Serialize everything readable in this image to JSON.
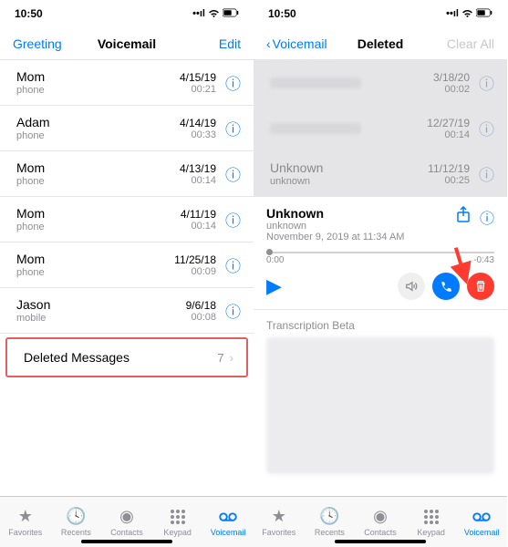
{
  "left": {
    "time": "10:50",
    "nav": {
      "left": "Greeting",
      "title": "Voicemail",
      "right": "Edit"
    },
    "rows": [
      {
        "name": "Mom",
        "sub": "phone",
        "date": "4/15/19",
        "dur": "00:21"
      },
      {
        "name": "Adam",
        "sub": "phone",
        "date": "4/14/19",
        "dur": "00:33"
      },
      {
        "name": "Mom",
        "sub": "phone",
        "date": "4/13/19",
        "dur": "00:14"
      },
      {
        "name": "Mom",
        "sub": "phone",
        "date": "4/11/19",
        "dur": "00:14"
      },
      {
        "name": "Mom",
        "sub": "phone",
        "date": "11/25/18",
        "dur": "00:09"
      },
      {
        "name": "Jason",
        "sub": "mobile",
        "date": "9/6/18",
        "dur": "00:08"
      }
    ],
    "deleted": {
      "label": "Deleted Messages",
      "count": "7"
    }
  },
  "right": {
    "time": "10:50",
    "nav": {
      "back": "Voicemail",
      "title": "Deleted",
      "right": "Clear All"
    },
    "grey_rows": [
      {
        "date": "3/18/20",
        "dur": "00:02"
      },
      {
        "date": "12/27/19",
        "dur": "00:14"
      },
      {
        "name": "Unknown",
        "sub": "unknown",
        "date": "11/12/19",
        "dur": "00:25"
      }
    ],
    "player": {
      "name": "Unknown",
      "sub": "unknown",
      "datetime": "November 9, 2019 at 11:34 AM",
      "elapsed": "0:00",
      "remaining": "-0:43"
    },
    "transcription_label": "Transcription Beta"
  },
  "tabs": [
    {
      "label": "Favorites"
    },
    {
      "label": "Recents"
    },
    {
      "label": "Contacts"
    },
    {
      "label": "Keypad"
    },
    {
      "label": "Voicemail"
    }
  ]
}
